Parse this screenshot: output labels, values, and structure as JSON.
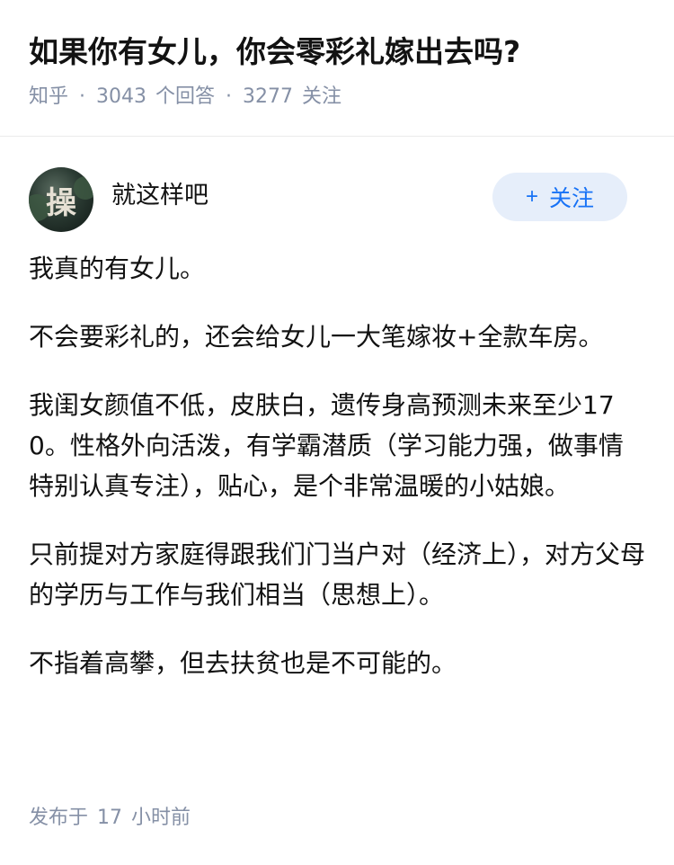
{
  "question": {
    "title": "如果你有女儿，你会零彩礼嫁出去吗?",
    "source": "知乎",
    "answer_count": "3043",
    "answer_label": "个回答",
    "follow_count": "3277",
    "follow_label": "关注"
  },
  "answer": {
    "author_name": "就这样吧",
    "avatar_text": "操",
    "follow_button_plus": "+",
    "follow_button_label": "关注",
    "paragraphs": [
      "我真的有女儿。",
      "不会要彩礼的，还会给女儿一大笔嫁妆+全款车房。",
      "我闺女颜值不低，皮肤白，遗传身高预测未来至少170。性格外向活泼，有学霸潜质（学习能力强，做事情特别认真专注），贴心，是个非常温暖的小姑娘。",
      "只前提对方家庭得跟我们门当户对（经济上），对方父母的学历与工作与我们相当（思想上）。",
      "不指着高攀，但去扶贫也是不可能的。"
    ],
    "publish_prefix": "发布于",
    "publish_num": "17",
    "publish_unit": "小时前"
  }
}
